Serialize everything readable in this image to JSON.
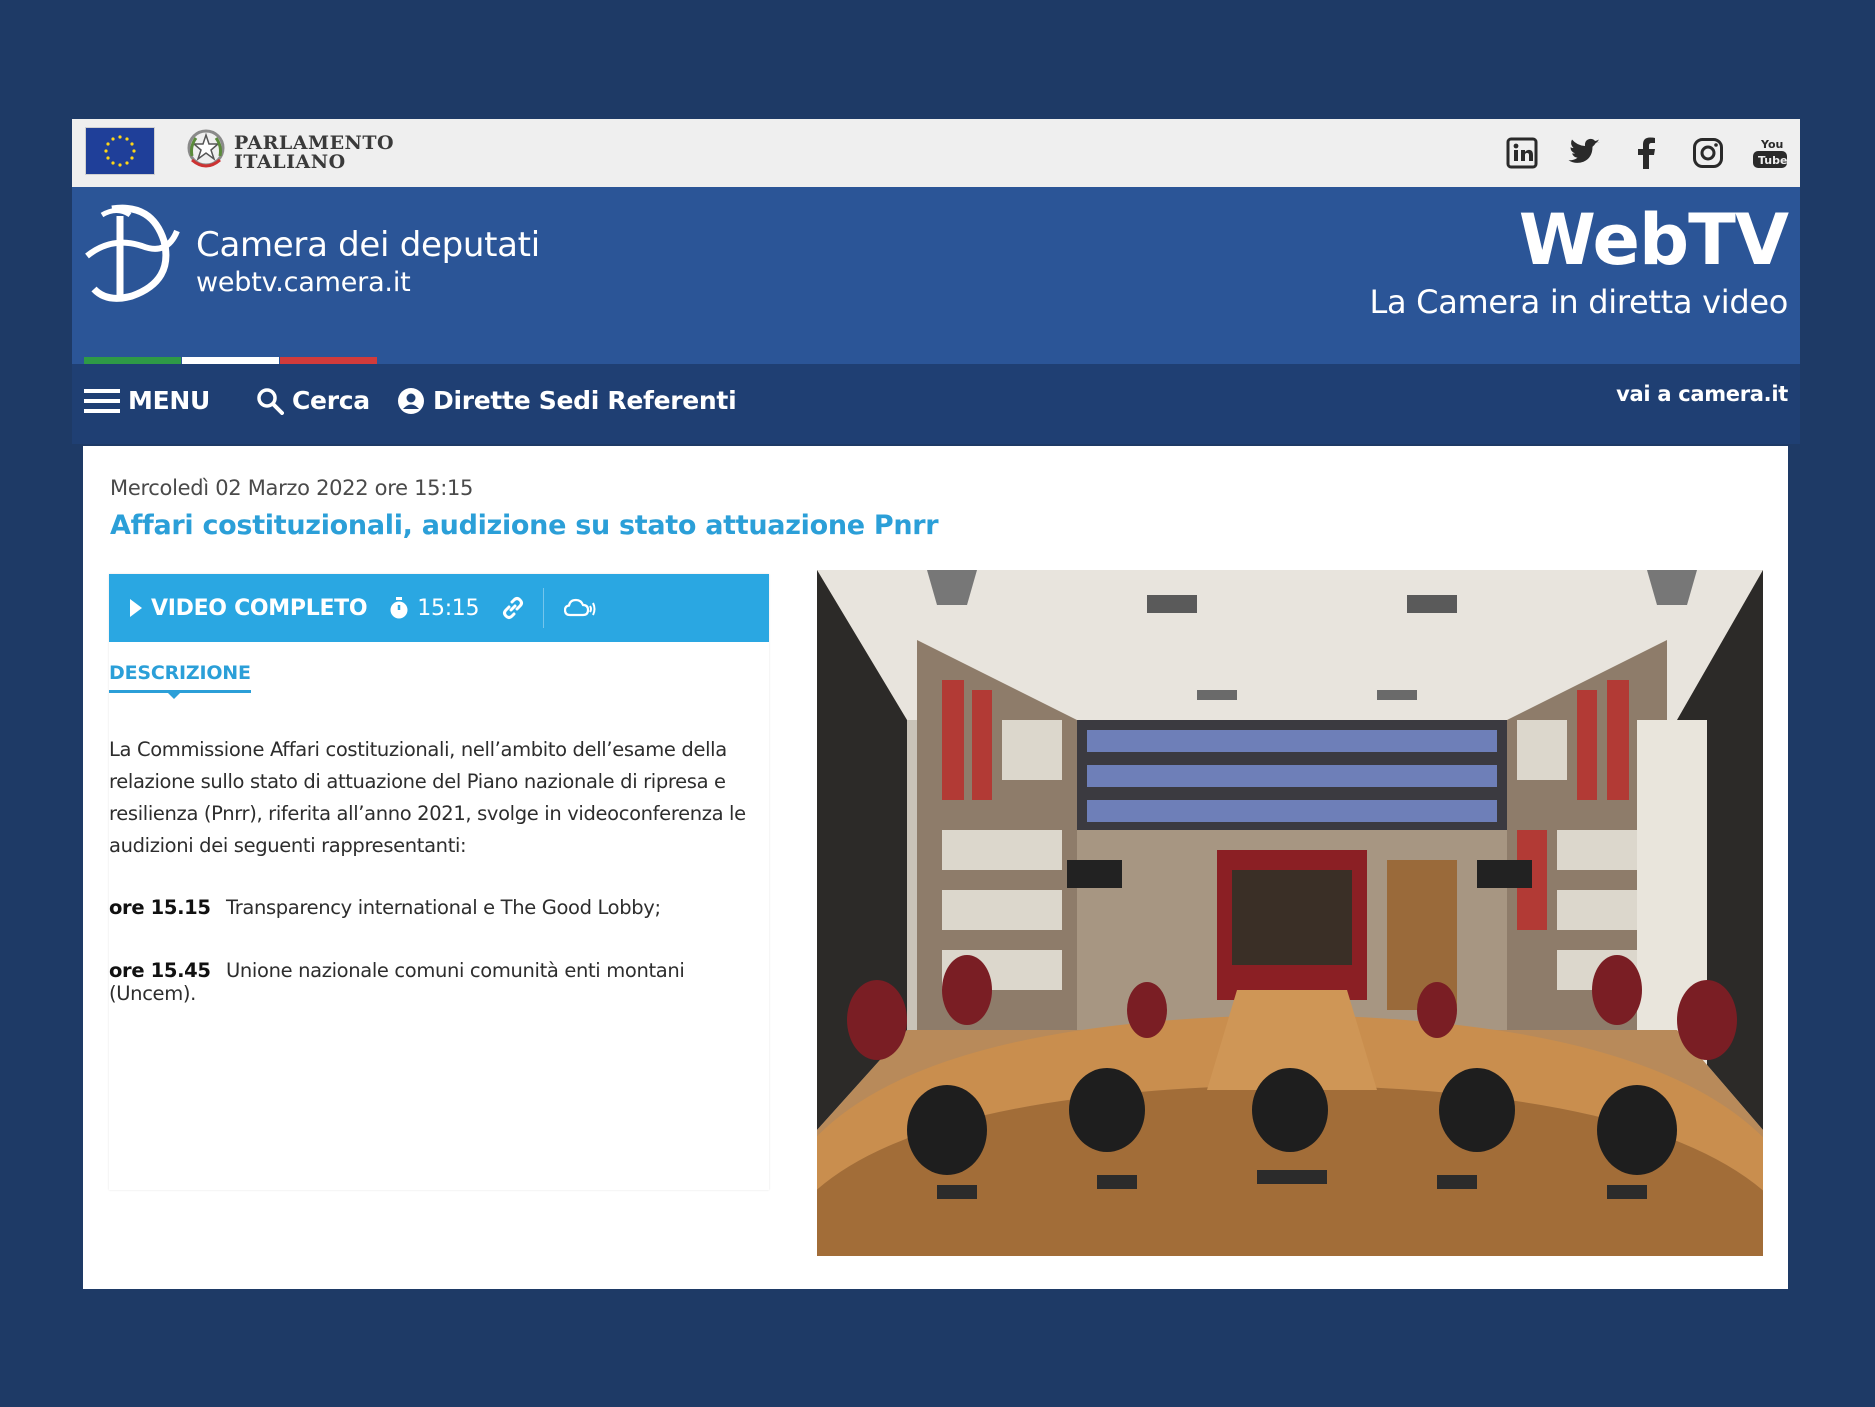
{
  "topbar": {
    "parlamento_line1": "PARLAMENTO",
    "parlamento_line2": "ITALIANO",
    "social_icons": [
      "linkedin-icon",
      "twitter-icon",
      "facebook-icon",
      "instagram-icon",
      "youtube-icon"
    ]
  },
  "header": {
    "camera_title": "Camera dei deputati",
    "camera_url": "webtv.camera.it",
    "webtv_title": "WebTV",
    "webtv_subtitle": "La Camera in diretta video"
  },
  "nav": {
    "menu": "MENU",
    "search": "Cerca",
    "dirette": "Dirette Sedi Referenti",
    "vai": "vai a camera.it"
  },
  "content": {
    "date": "Mercoledì 02 Marzo 2022 ore 15:15",
    "title": "Affari costituzionali, audizione su stato attuazione Pnrr",
    "video_label": "VIDEO COMPLETO",
    "duration": "15:15",
    "tab_label": "DESCRIZIONE",
    "description": "La Commissione Affari costituzionali, nell’ambito dell’esame della relazione sullo stato di attuazione del Piano nazionale di ripresa e resilienza (Pnrr), riferita all’anno 2021, svolge in videoconferenza le audizioni dei seguenti rappresentanti:",
    "schedule": [
      {
        "time": "ore 15.15",
        "text": "Transparency international e The Good Lobby;"
      },
      {
        "time": "ore 15.45",
        "text": "Unione nazionale comuni comunità enti montani (Uncem)."
      }
    ]
  },
  "colors": {
    "page_bg": "#1e3a66",
    "header_blue": "#2b5597",
    "nav_blue": "#1f3f73",
    "accent": "#2aa7e2",
    "green": "#2e9a46",
    "white": "#ffffff",
    "red": "#d13b3b"
  }
}
